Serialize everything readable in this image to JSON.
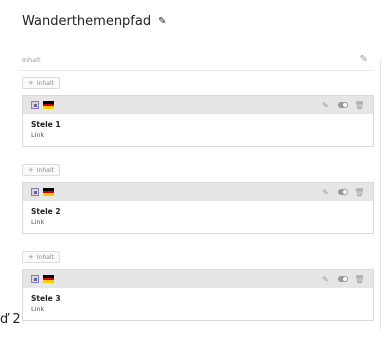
{
  "page": {
    "title": "Wanderthemenpfad"
  },
  "panel": {
    "label": "Inhalt"
  },
  "add_button": {
    "label": "Inhalt"
  },
  "cards": [
    {
      "title": "Stele 1",
      "subtitle": "Link"
    },
    {
      "title": "Stele 2",
      "subtitle": "Link"
    },
    {
      "title": "Stele 3",
      "subtitle": "Link"
    }
  ],
  "bottom_text": "ď 2",
  "icons": {
    "title_edit": "pencil-icon",
    "panel_edit": "edit-icon",
    "card_type": "content-type-icon",
    "language": "german-flag-icon",
    "card_actions": [
      "pencil-icon",
      "toggle-icon",
      "trash-icon"
    ]
  }
}
